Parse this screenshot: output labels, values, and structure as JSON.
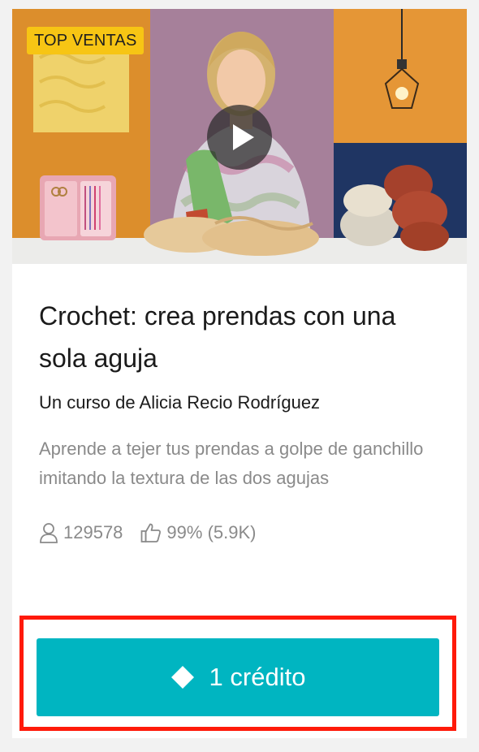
{
  "course": {
    "badge": "TOP VENTAS",
    "title": "Crochet: crea prendas con una sola aguja",
    "author": "Un curso de Alicia Recio Rodríguez",
    "description": "Aprende a tejer tus prendas a golpe de ganchillo imitando la textura de las dos agujas",
    "students": "129578",
    "rating": "99% (5.9K)"
  },
  "cta": {
    "label": "1 crédito",
    "icon": "diamond-icon"
  },
  "icons": {
    "play": "play-icon",
    "students": "user-icon",
    "rating": "thumbs-up-icon"
  },
  "colors": {
    "badge": "#f7c514",
    "cta": "#00b5c1",
    "highlight": "#ff1a0a",
    "muted_text": "#8a8a8a"
  }
}
